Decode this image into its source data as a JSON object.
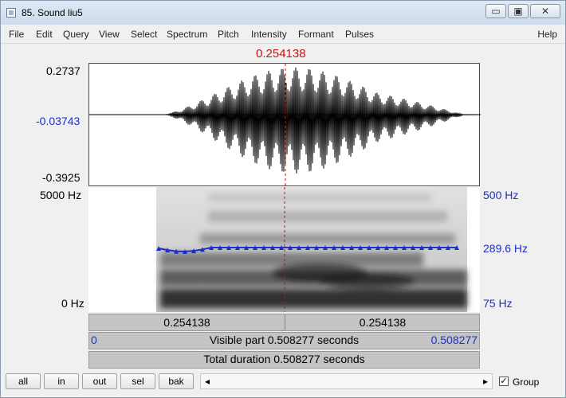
{
  "window": {
    "title": "85. Sound liu5",
    "minimize_glyph": "▭",
    "maximize_glyph": "▣",
    "close_glyph": "✕"
  },
  "menu": {
    "items": [
      "File",
      "Edit",
      "Query",
      "View",
      "Select",
      "Spectrum",
      "Pitch",
      "Intensity",
      "Formant",
      "Pulses"
    ],
    "help": "Help"
  },
  "cursor": {
    "time": "0.254138"
  },
  "waveform": {
    "max": "0.2737",
    "mid": "-0.03743",
    "min": "-0.3925"
  },
  "spectrogram": {
    "freq_top": "5000 Hz",
    "freq_bottom": "0 Hz",
    "pitch_top": "500 Hz",
    "pitch_value": "289.6 Hz",
    "pitch_bottom": "75 Hz"
  },
  "scale": {
    "left_segment": "0.254138",
    "right_segment": "0.254138",
    "visible_start": "0",
    "visible_text": "Visible part 0.508277 seconds",
    "visible_end": "0.508277",
    "total_text": "Total duration 0.508277 seconds"
  },
  "buttons": {
    "all": "all",
    "in": "in",
    "out": "out",
    "sel": "sel",
    "bak": "bak"
  },
  "scroll": {
    "left": "◂",
    "right": "▸"
  },
  "group": {
    "label": "Group",
    "checked": "✓"
  },
  "colors": {
    "cursor": "#cc1111",
    "pitch": "#1d2ecb"
  }
}
